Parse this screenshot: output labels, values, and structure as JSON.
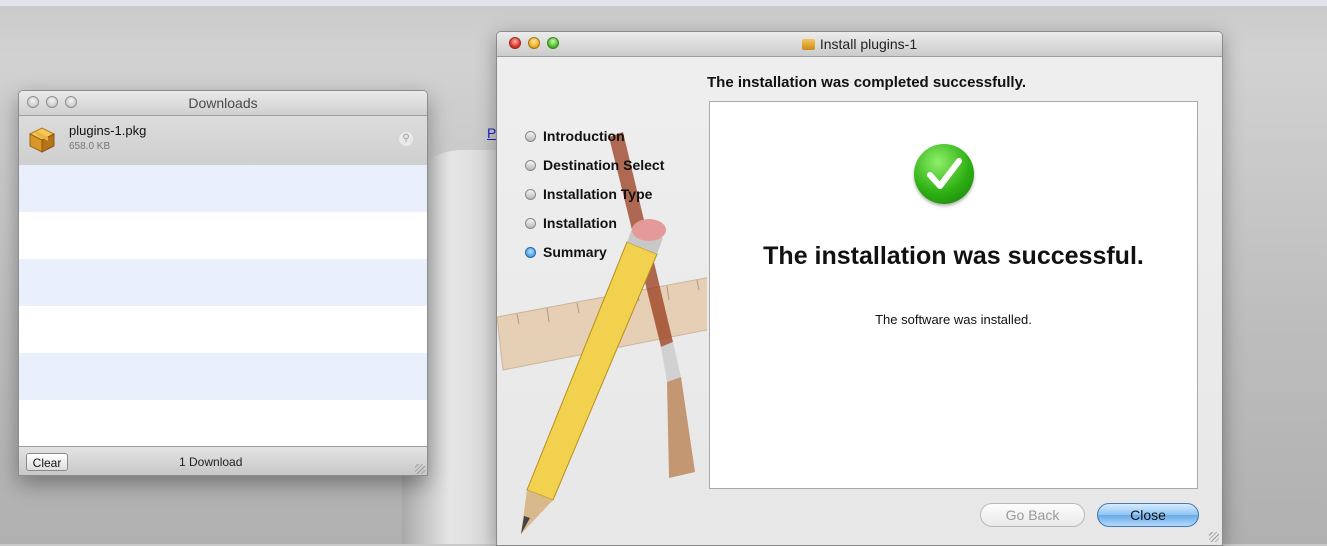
{
  "background": {
    "link_text": "P"
  },
  "downloads_window": {
    "title": "Downloads",
    "items": [
      {
        "name": "plugins-1.pkg",
        "size": "658.0 KB"
      }
    ],
    "clear_label": "Clear",
    "count_label": "1 Download"
  },
  "installer_window": {
    "title": "Install plugins-1",
    "header": "The installation was completed successfully.",
    "steps": [
      {
        "label": "Introduction",
        "active": false
      },
      {
        "label": "Destination Select",
        "active": false
      },
      {
        "label": "Installation Type",
        "active": false
      },
      {
        "label": "Installation",
        "active": false
      },
      {
        "label": "Summary",
        "active": true
      }
    ],
    "main_message": "The installation was successful.",
    "sub_message": "The software was installed.",
    "back_label": "Go Back",
    "close_label": "Close"
  },
  "colors": {
    "success_green": "#2fb114",
    "selected_button": "#8dc4f2"
  },
  "icons": [
    "package-icon",
    "magnifier-icon",
    "checkmark-icon",
    "pencil-icon",
    "brush-icon",
    "ruler-icon"
  ]
}
